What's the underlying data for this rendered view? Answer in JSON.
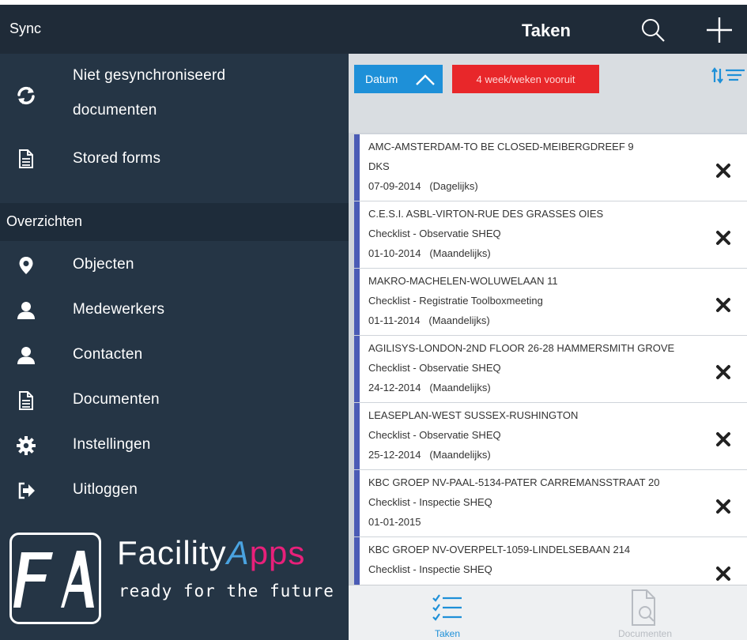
{
  "header": {
    "sync_title": "Sync",
    "page_title": "Taken"
  },
  "sidebar": {
    "items": [
      {
        "label_line1": "Niet gesynchroniseerd",
        "label_line2": "documenten",
        "icon": "sync-icon"
      },
      {
        "label": "Stored forms",
        "icon": "document-icon"
      }
    ],
    "section_title": "Overzichten",
    "nav": [
      {
        "label": "Objecten",
        "icon": "map-marker-icon"
      },
      {
        "label": "Medewerkers",
        "icon": "user-icon"
      },
      {
        "label": "Contacten",
        "icon": "user-icon"
      },
      {
        "label": "Documenten",
        "icon": "document-icon"
      },
      {
        "label": "Instellingen",
        "icon": "gear-icon"
      },
      {
        "label": "Uitloggen",
        "icon": "logout-icon"
      }
    ]
  },
  "logo": {
    "mark": "FA",
    "name_part1": "Facility",
    "name_part2": "A",
    "name_part3": "pps",
    "tagline": "ready for the future"
  },
  "filters": {
    "date_label": "Datum",
    "period_label": "4 week/weken vooruit"
  },
  "tasks": [
    {
      "name": "AMC-AMSTERDAM-TO BE CLOSED-MEIBERGDREEF 9",
      "line2": "DKS",
      "date": "07-09-2014",
      "recurrence": "(Dagelijks)"
    },
    {
      "name": "C.E.S.I. ASBL-VIRTON-RUE DES GRASSES OIES",
      "line2": "Checklist - Observatie SHEQ",
      "date": "01-10-2014",
      "recurrence": "(Maandelijks)"
    },
    {
      "name": "MAKRO-MACHELEN-WOLUWELAAN 11",
      "line2": "Checklist - Registratie Toolboxmeeting",
      "date": "01-11-2014",
      "recurrence": "(Maandelijks)"
    },
    {
      "name": "AGILISYS-LONDON-2ND FLOOR 26-28 HAMMERSMITH GROVE",
      "line2": "Checklist - Observatie SHEQ",
      "date": "24-12-2014",
      "recurrence": "(Maandelijks)"
    },
    {
      "name": "LEASEPLAN-WEST SUSSEX-RUSHINGTON",
      "line2": "Checklist - Observatie SHEQ",
      "date": "25-12-2014",
      "recurrence": "(Maandelijks)"
    },
    {
      "name": "KBC GROEP NV-PAAL-5134-PATER CARREMANSSTRAAT 20",
      "line2": "Checklist - Inspectie SHEQ",
      "date": "01-01-2015",
      "recurrence": ""
    },
    {
      "name": "KBC GROEP NV-OVERPELT-1059-LINDELSEBAAN 214",
      "line2": "Checklist - Inspectie SHEQ",
      "date": "",
      "recurrence": ""
    }
  ],
  "tabs": [
    {
      "label": "Taken",
      "icon": "checklist-icon",
      "active": true
    },
    {
      "label": "Documenten",
      "icon": "document-search-icon",
      "active": false
    }
  ],
  "colors": {
    "sidebar_bg": "#253545",
    "topbar_bg": "#1f2b38",
    "accent_blue": "#1e90d8",
    "accent_red": "#e8272a",
    "task_border": "#4a5bb5"
  }
}
